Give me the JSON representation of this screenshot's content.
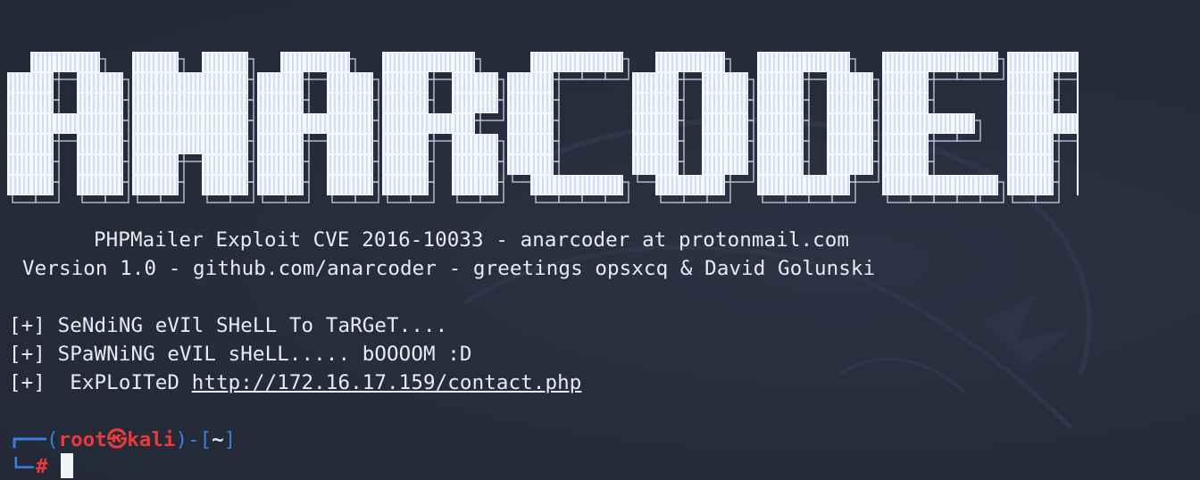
{
  "terminal": {
    "banner_text": "ANARCODER",
    "info_line1": "PHPMailer Exploit CVE 2016-10033 - anarcoder at protonmail.com",
    "info_line2": "Version 1.0 - github.com/anarcoder - greetings opsxcq & David Golunski",
    "out1": "[+] SeNdiNG eVIl SHeLL To TaRGeT....",
    "out2": "[+] SPaWNiNG eVIL sHeLL..... bOOOOM :D",
    "out3_prefix": "[+]  ExPLoITeD ",
    "out3_url": "http://172.16.17.159/contact.php",
    "prompt": {
      "open_paren": "(",
      "user": "root",
      "at_symbol": "㉿",
      "host": "kali",
      "close_paren": ")-[",
      "cwd": "~",
      "close_bracket": "]",
      "hash": "#"
    },
    "icons": {
      "watermark": "kali-dragon-icon",
      "cursor": "block-cursor"
    },
    "colors": {
      "background": "#262d3b",
      "text": "#e6e9ee",
      "prompt_frame": "#3c7fdb",
      "prompt_user": "#e83a3a"
    }
  }
}
